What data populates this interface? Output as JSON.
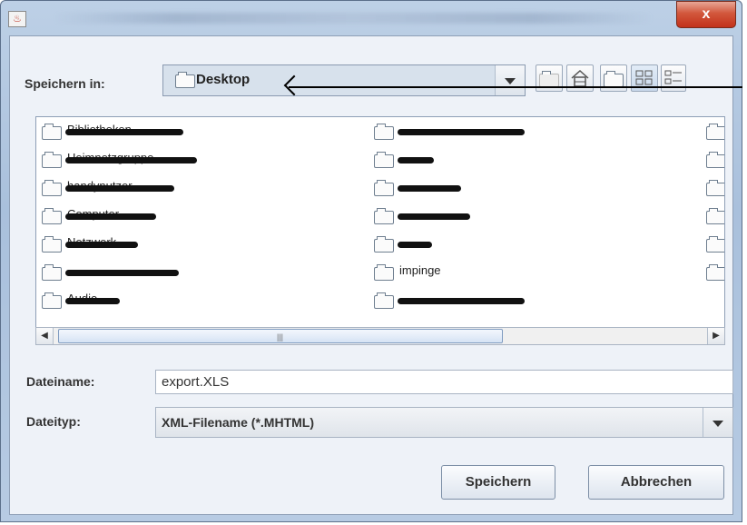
{
  "window": {
    "close_glyph": "x"
  },
  "save_in": {
    "label": "Speichern in:",
    "value": "Desktop"
  },
  "toolbar": {
    "up_icon": "up-folder-icon",
    "home_icon": "home-icon",
    "new_folder_icon": "new-folder-icon",
    "list_view_icon": "list-view-icon",
    "details_view_icon": "details-view-icon"
  },
  "files": {
    "column1": [
      "Bibliotheken",
      "Heimnetzgruppe",
      "handynutzer",
      "Computer",
      "Netzwerk",
      "",
      "Audio"
    ],
    "column2": [
      "",
      "",
      "",
      "",
      "",
      "impinge",
      ""
    ]
  },
  "scroll": {
    "grip": "|||"
  },
  "filename": {
    "label": "Dateiname:",
    "value": "export.XLS"
  },
  "filetype": {
    "label": "Dateityp:",
    "value": "XML-Filename (*.MHTML)"
  },
  "buttons": {
    "save": "Speichern",
    "cancel": "Abbrechen"
  }
}
